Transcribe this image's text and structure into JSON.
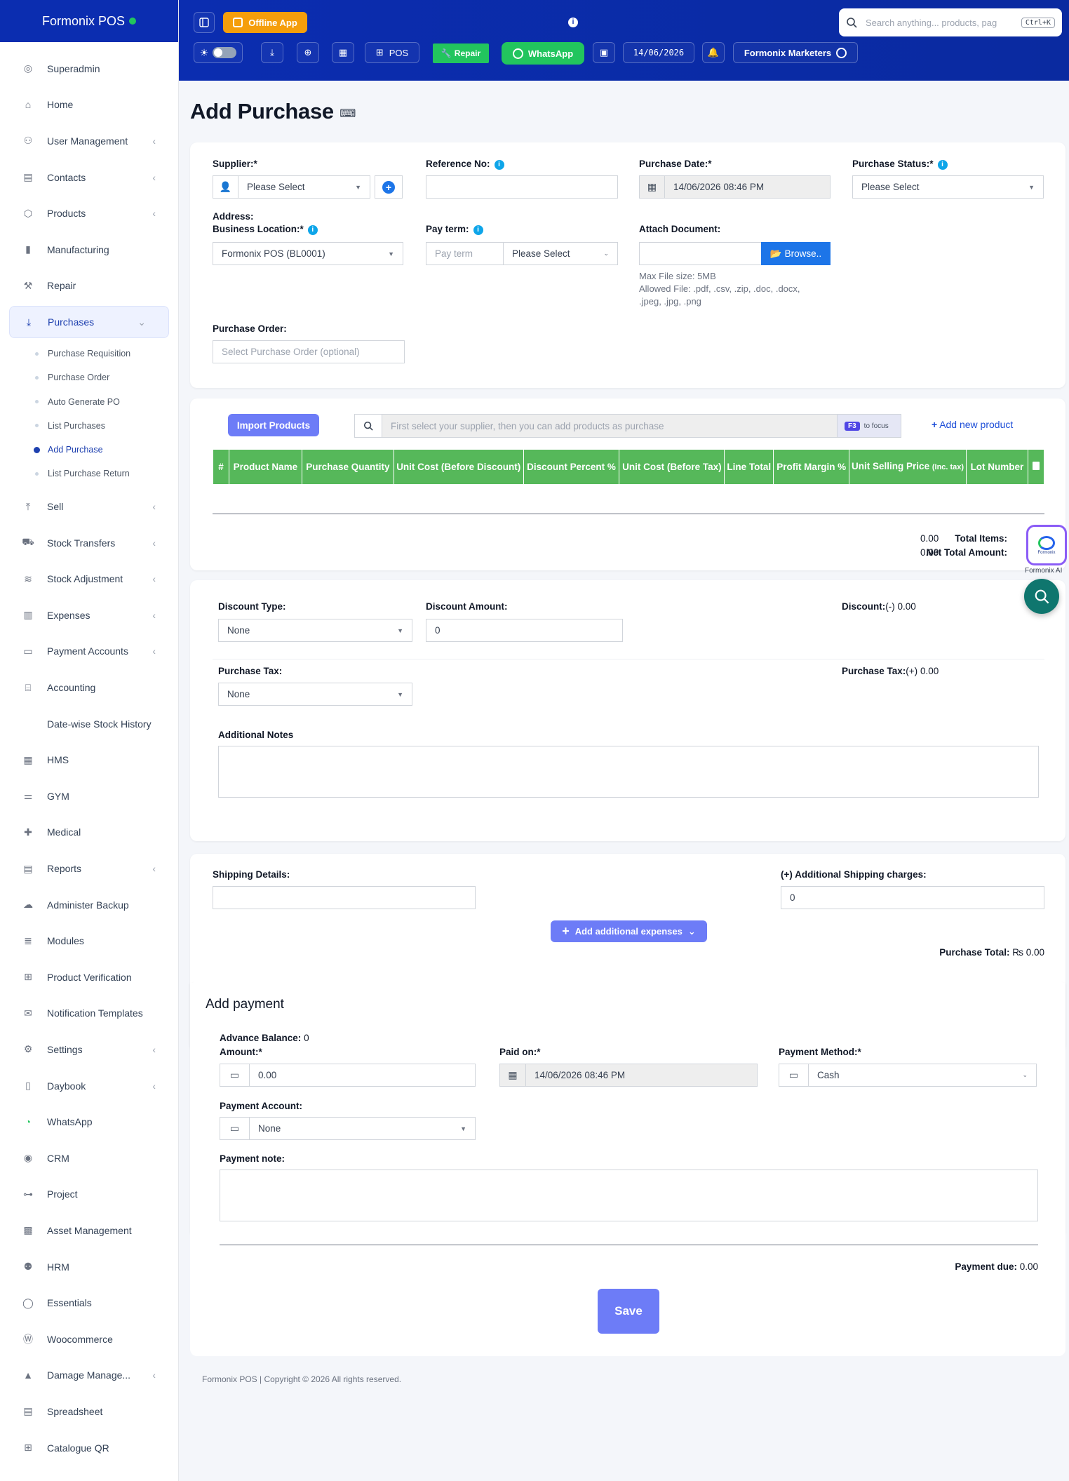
{
  "app": {
    "brand": "Formonix POS"
  },
  "sidebar": {
    "items": [
      {
        "label": "Superadmin",
        "icon": "user-icon"
      },
      {
        "label": "Home",
        "icon": "home-icon"
      },
      {
        "label": "User Management",
        "icon": "users-icon",
        "chevron": true
      },
      {
        "label": "Contacts",
        "icon": "contacts-icon",
        "chevron": true
      },
      {
        "label": "Products",
        "icon": "box-icon",
        "chevron": true
      },
      {
        "label": "Manufacturing",
        "icon": "chart-icon"
      },
      {
        "label": "Repair",
        "icon": "wrench-icon"
      },
      {
        "label": "Purchases",
        "icon": "download-icon",
        "chevron": true,
        "active": true
      }
    ],
    "purchases_sub": [
      {
        "label": "Purchase Requisition"
      },
      {
        "label": "Purchase Order"
      },
      {
        "label": "Auto Generate PO"
      },
      {
        "label": "List Purchases"
      },
      {
        "label": "Add Purchase",
        "current": true
      },
      {
        "label": "List Purchase Return"
      }
    ],
    "items_after": [
      {
        "label": "Sell",
        "icon": "upload-icon",
        "chevron": true
      },
      {
        "label": "Stock Transfers",
        "icon": "truck-icon",
        "chevron": true
      },
      {
        "label": "Stock Adjustment",
        "icon": "database-icon",
        "chevron": true
      },
      {
        "label": "Expenses",
        "icon": "receipt-icon",
        "chevron": true
      },
      {
        "label": "Payment Accounts",
        "icon": "wallet-icon",
        "chevron": true
      },
      {
        "label": "Accounting",
        "icon": "bank-icon"
      },
      {
        "label": "Date-wise Stock History",
        "icon": ""
      },
      {
        "label": "HMS",
        "icon": "building-icon"
      },
      {
        "label": "GYM",
        "icon": "dumbbell-icon"
      },
      {
        "label": "Medical",
        "icon": "medical-icon"
      },
      {
        "label": "Reports",
        "icon": "clipboard-icon",
        "chevron": true
      },
      {
        "label": "Administer Backup",
        "icon": "cloud-icon"
      },
      {
        "label": "Modules",
        "icon": "layers-icon"
      },
      {
        "label": "Product Verification",
        "icon": "grid-icon"
      },
      {
        "label": "Notification Templates",
        "icon": "mail-icon"
      },
      {
        "label": "Settings",
        "icon": "gear-icon",
        "chevron": true
      },
      {
        "label": "Daybook",
        "icon": "book-icon",
        "chevron": true
      },
      {
        "label": "WhatsApp",
        "icon": "whatsapp-icon"
      },
      {
        "label": "CRM",
        "icon": "broadcast-icon"
      },
      {
        "label": "Project",
        "icon": "project-icon"
      },
      {
        "label": "Asset Management",
        "icon": "boxes-icon"
      },
      {
        "label": "HRM",
        "icon": "team-icon"
      },
      {
        "label": "Essentials",
        "icon": "check-circle-icon"
      },
      {
        "label": "Woocommerce",
        "icon": "wordpress-icon"
      },
      {
        "label": "Damage Manage...",
        "icon": "warning-icon",
        "chevron": true
      },
      {
        "label": "Spreadsheet",
        "icon": "sheet-icon"
      },
      {
        "label": "Catalogue QR",
        "icon": "qr-icon"
      }
    ]
  },
  "topbar": {
    "offline_label": "Offline App",
    "pos_label": "POS",
    "repair_label": "Repair",
    "whatsapp_label": "WhatsApp",
    "date": "14/06/2026",
    "business": "Formonix Marketers",
    "search_placeholder": "Search anything... products, pag",
    "search_kbd": "Ctrl+K"
  },
  "page": {
    "title": "Add Purchase"
  },
  "form": {
    "supplier_label": "Supplier:*",
    "supplier_value": "Please Select",
    "reference_label": "Reference No:",
    "purchase_date_label": "Purchase Date:*",
    "purchase_date_value": "14/06/2026 08:46 PM",
    "purchase_status_label": "Purchase Status:*",
    "purchase_status_value": "Please Select",
    "address_label": "Address:",
    "business_location_label": "Business Location:*",
    "business_location_value": "Formonix POS (BL0001)",
    "pay_term_label": "Pay term:",
    "pay_term_placeholder": "Pay term",
    "pay_term_unit": "Please Select",
    "attach_label": "Attach Document:",
    "browse_label": "Browse..",
    "max_file": "Max File size: 5MB",
    "allowed_file_1": "Allowed File: .pdf, .csv, .zip, .doc, .docx,",
    "allowed_file_2": ".jpeg, .jpg, .png",
    "purchase_order_label": "Purchase Order:",
    "purchase_order_placeholder": "Select Purchase Order (optional)"
  },
  "products": {
    "import_label": "Import Products",
    "search_placeholder": "First select your supplier, then you can add products as purchase",
    "focus_key": "F3",
    "focus_text": "to focus",
    "add_new_label": "Add new product",
    "columns": [
      "#",
      "Product Name",
      "Purchase Quantity",
      "Unit Cost (Before Discount)",
      "Discount Percent %",
      "Unit Cost (Before Tax)",
      "Line Total",
      "Profit Margin %",
      "Unit Selling Price",
      "Lot Number"
    ],
    "usp_suffix": "(Inc. tax)",
    "total_items_label": "Total Items:",
    "total_items_value": "0.00",
    "net_total_label": "Net Total Amount:",
    "net_total_value": "0.00"
  },
  "discount": {
    "type_label": "Discount Type:",
    "type_value": "None",
    "amount_label": "Discount Amount:",
    "amount_value": "0",
    "summary_label": "Discount:",
    "summary_sign": "(-)",
    "summary_value": "0.00",
    "tax_label": "Purchase Tax:",
    "tax_value": "None",
    "tax_summary_label": "Purchase Tax:",
    "tax_summary_sign": "(+)",
    "tax_summary_value": "0.00",
    "notes_label": "Additional Notes"
  },
  "shipping": {
    "details_label": "Shipping Details:",
    "charges_label": "(+) Additional Shipping charges:",
    "charges_value": "0",
    "add_expenses_label": "Add additional expenses",
    "total_label": "Purchase Total:",
    "total_value": "₨ 0.00"
  },
  "payment": {
    "title": "Add payment",
    "advance_label": "Advance Balance:",
    "advance_value": "0",
    "amount_label": "Amount:*",
    "amount_value": "0.00",
    "paid_on_label": "Paid on:*",
    "paid_on_value": "14/06/2026 08:46 PM",
    "method_label": "Payment Method:*",
    "method_value": "Cash",
    "account_label": "Payment Account:",
    "account_value": "None",
    "note_label": "Payment note:",
    "due_label": "Payment due:",
    "due_value": "0.00",
    "save_label": "Save"
  },
  "widgets": {
    "ai_label": "Formonix AI",
    "ai_logo_text": "Formonix"
  },
  "footer": {
    "text": "Formonix POS | Copyright © 2026 All rights reserved."
  },
  "colors": {
    "primary": "#0b2db0",
    "green": "#56b85a",
    "accent": "#6d7cf7",
    "blue": "#1d75e8"
  }
}
